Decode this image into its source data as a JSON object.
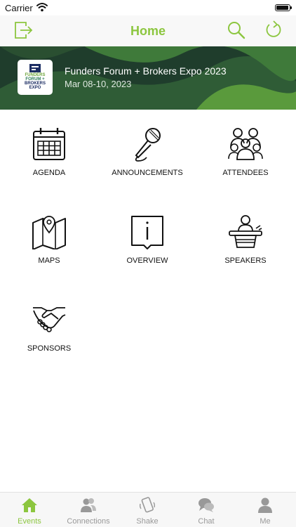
{
  "status_bar": {
    "carrier": "Carrier",
    "battery_level": 0.95
  },
  "header": {
    "title": "Home"
  },
  "event": {
    "title": "Funders Forum + Brokers Expo 2023",
    "dates": "Mar 08-10, 2023",
    "logo_lines": [
      "FUNDERS",
      "FORUM +",
      "BROKERS",
      "EXPO"
    ]
  },
  "features": [
    {
      "label": "AGENDA",
      "icon": "calendar-icon"
    },
    {
      "label": "ANNOUNCEMENTS",
      "icon": "microphone-icon"
    },
    {
      "label": "ATTENDEES",
      "icon": "people-group-icon"
    },
    {
      "label": "MAPS",
      "icon": "map-pin-icon"
    },
    {
      "label": "OVERVIEW",
      "icon": "info-icon"
    },
    {
      "label": "SPEAKERS",
      "icon": "podium-icon"
    },
    {
      "label": "SPONSORS",
      "icon": "handshake-icon"
    }
  ],
  "tabs": [
    {
      "label": "Events",
      "icon": "house-icon",
      "active": true
    },
    {
      "label": "Connections",
      "icon": "connections-icon",
      "active": false
    },
    {
      "label": "Shake",
      "icon": "shake-phone-icon",
      "active": false
    },
    {
      "label": "Chat",
      "icon": "chat-bubbles-icon",
      "active": false
    },
    {
      "label": "Me",
      "icon": "person-icon",
      "active": false
    }
  ],
  "colors": {
    "accent": "#8cc63f",
    "banner": "#1f3d2c",
    "inactive_tab": "#999999"
  }
}
